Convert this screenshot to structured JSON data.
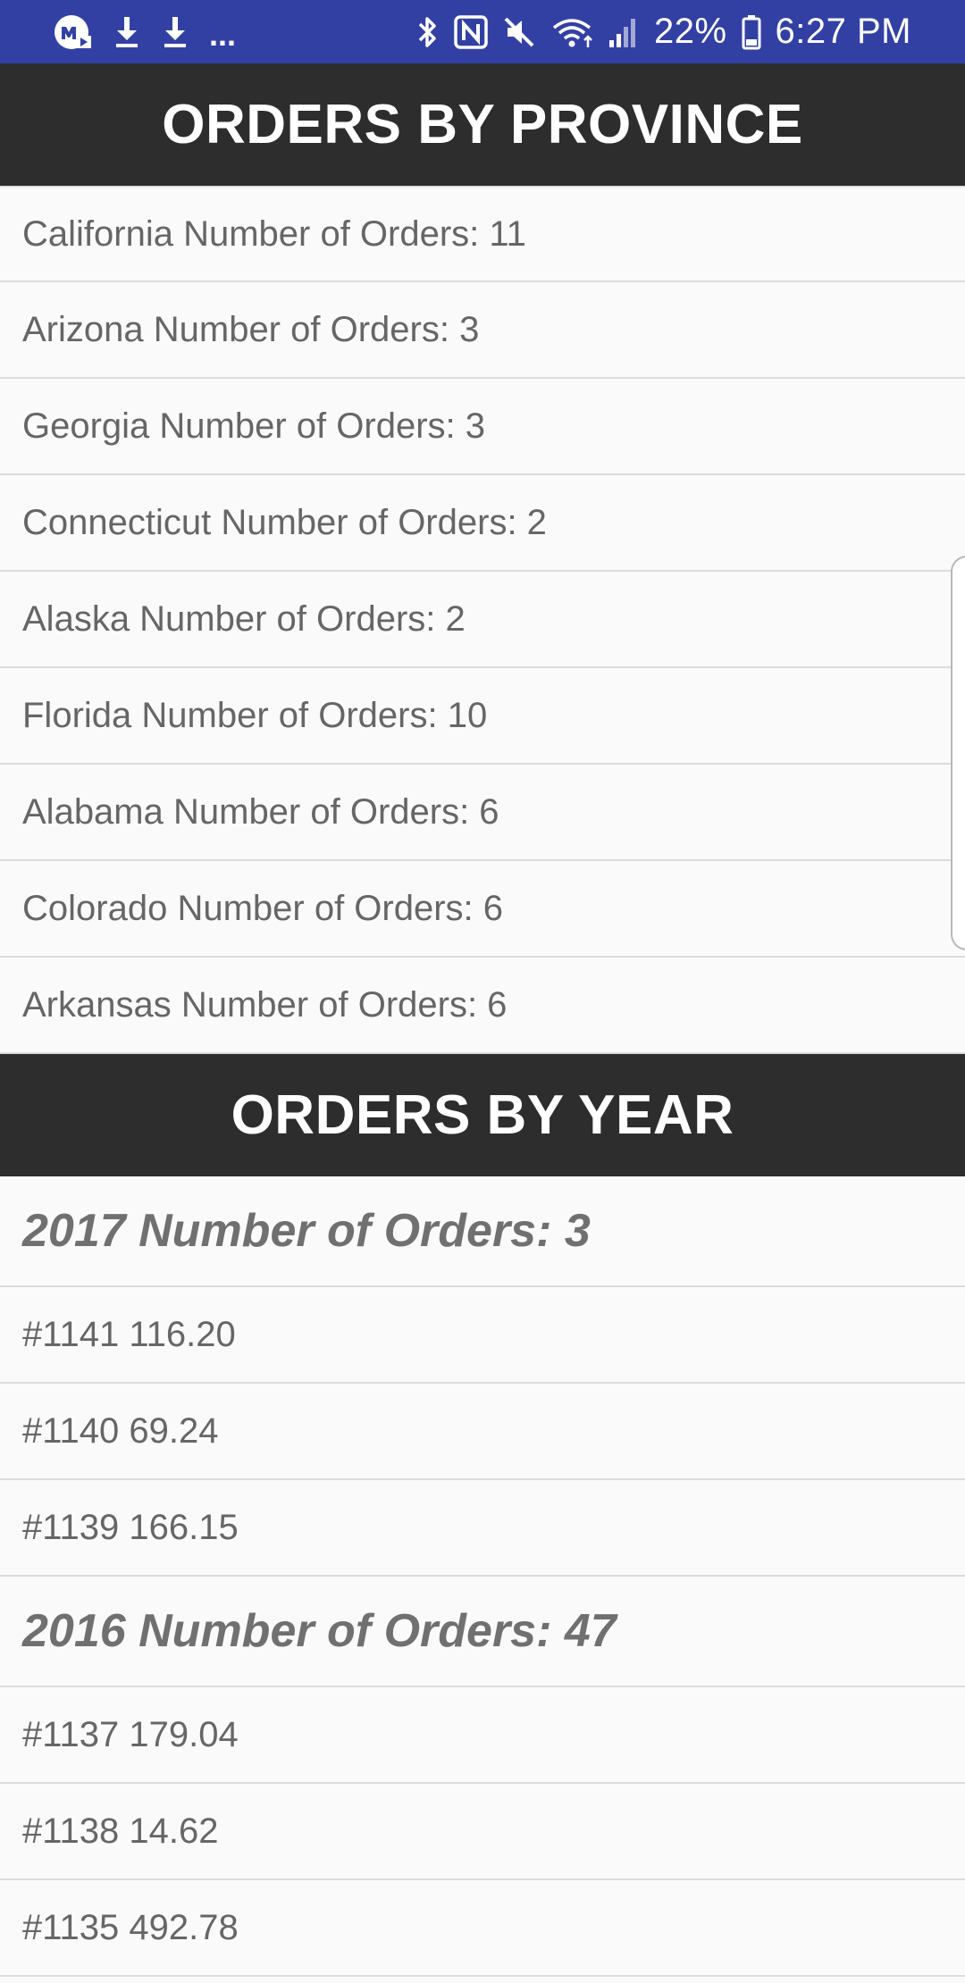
{
  "status_bar": {
    "icons_left": [
      "messenger-icon",
      "download-icon",
      "download-icon"
    ],
    "more": "...",
    "icons_right": [
      "bluetooth-icon",
      "nfc-icon",
      "mute-icon",
      "wifi-icon",
      "signal-icon",
      "battery-icon"
    ],
    "battery": "22%",
    "time": "6:27 PM"
  },
  "province_section": {
    "title": "ORDERS BY PROVINCE",
    "items": [
      "California Number of Orders: 11",
      "Arizona Number of Orders: 3",
      "Georgia Number of Orders: 3",
      "Connecticut Number of Orders: 2",
      "Alaska Number of Orders: 2",
      "Florida Number of Orders: 10",
      "Alabama Number of Orders: 6",
      "Colorado Number of Orders: 6",
      "Arkansas Number of Orders: 6"
    ]
  },
  "year_section": {
    "title": "ORDERS BY YEAR",
    "groups": [
      {
        "heading": "2017 Number of Orders: 3",
        "orders": [
          "#1141 116.20",
          "#1140 69.24",
          "#1139 166.15"
        ]
      },
      {
        "heading": "2016 Number of Orders: 47",
        "orders": [
          "#1137 179.04",
          "#1138 14.62",
          "#1135 492.78"
        ]
      }
    ]
  },
  "colors": {
    "status_bar": "#3340a3",
    "header_bg": "#2d2d2d",
    "row_text": "#666666",
    "background": "#fafafa"
  }
}
